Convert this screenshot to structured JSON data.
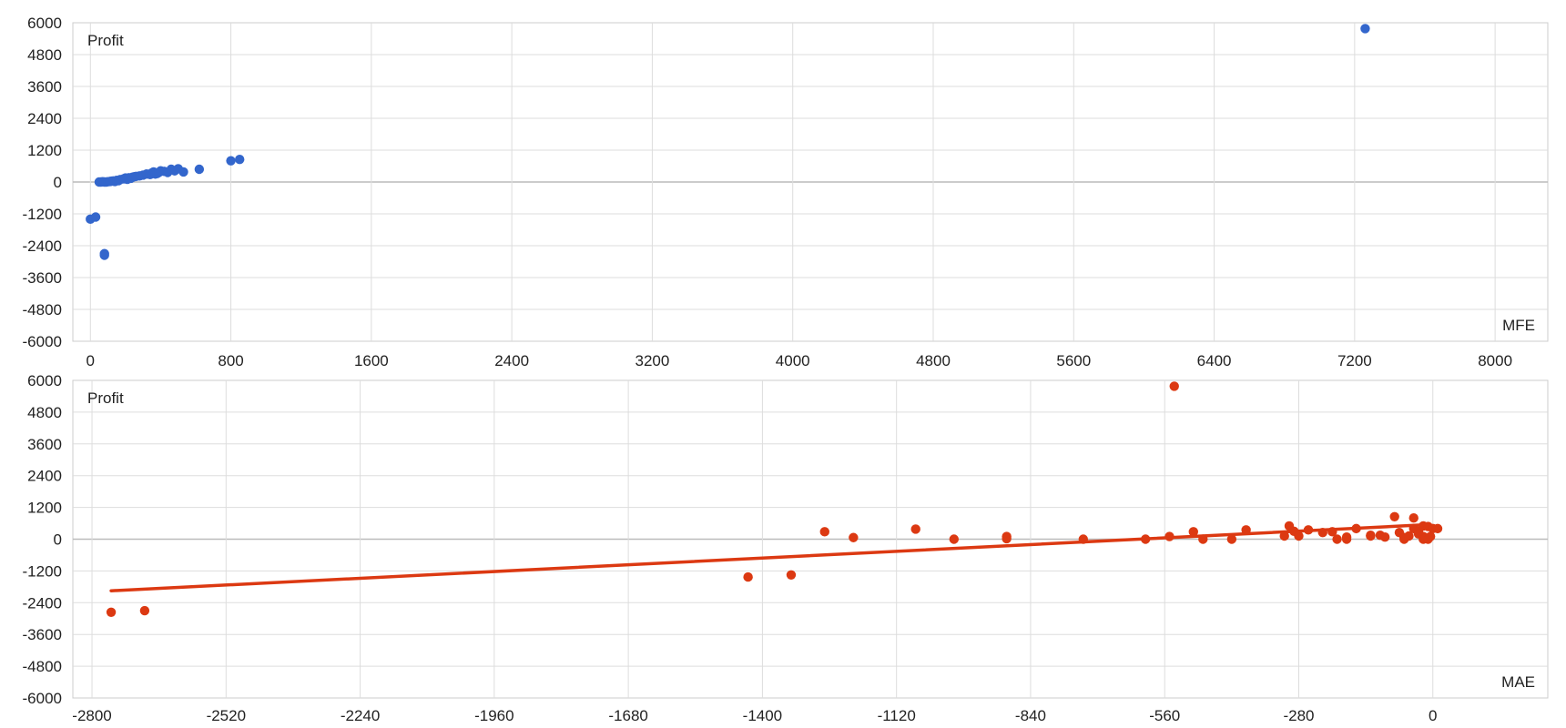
{
  "chart_data": [
    {
      "type": "scatter",
      "ylabel": "Profit",
      "xlabel": "MFE",
      "xlim": [
        -100,
        8300
      ],
      "ylim": [
        -6000,
        6000
      ],
      "x_ticks": [
        "0",
        "800",
        "1600",
        "2400",
        "3200",
        "4000",
        "4800",
        "5600",
        "6400",
        "7200",
        "8000"
      ],
      "y_ticks": [
        "6000",
        "4800",
        "3600",
        "2400",
        "1200",
        "0",
        "-1200",
        "-2400",
        "-3600",
        "-4800",
        "-6000"
      ],
      "grid": true,
      "color": "#3366cc",
      "series": [
        {
          "x": [
            0,
            30,
            80,
            80,
            50,
            60,
            70,
            80,
            90,
            100,
            110,
            120,
            130,
            140,
            150,
            160,
            170,
            190,
            200,
            210,
            220,
            230,
            240,
            250,
            260,
            280,
            300,
            320,
            340,
            350,
            360,
            370,
            380,
            390,
            400,
            420,
            440,
            460,
            480,
            500,
            530,
            620,
            800,
            850,
            7260
          ],
          "y": [
            -1400,
            -1320,
            -2700,
            -2760,
            0,
            0,
            10,
            0,
            0,
            10,
            20,
            30,
            40,
            20,
            60,
            50,
            90,
            120,
            150,
            100,
            160,
            140,
            180,
            200,
            210,
            230,
            260,
            300,
            280,
            340,
            380,
            300,
            320,
            360,
            420,
            400,
            360,
            480,
            420,
            500,
            380,
            480,
            800,
            850,
            5780
          ]
        }
      ]
    },
    {
      "type": "scatter",
      "ylabel": "Profit",
      "xlabel": "MAE",
      "xlim": [
        -2840,
        240
      ],
      "ylim": [
        -6000,
        6000
      ],
      "x_ticks": [
        "-2800",
        "-2520",
        "-2240",
        "-1960",
        "-1680",
        "-1400",
        "-1120",
        "-840",
        "-560",
        "-280",
        "0"
      ],
      "y_ticks": [
        "6000",
        "4800",
        "3600",
        "2400",
        "1200",
        "0",
        "-1200",
        "-2400",
        "-3600",
        "-4800",
        "-6000"
      ],
      "grid": true,
      "color": "#dc3912",
      "series": [
        {
          "x": [
            -2760,
            -2690,
            -1430,
            -1340,
            -1270,
            -1210,
            -1080,
            -1000,
            -890,
            -890,
            -730,
            -600,
            -550,
            -540,
            -500,
            -480,
            -420,
            -390,
            -310,
            -300,
            -290,
            -280,
            -260,
            -230,
            -210,
            -200,
            -180,
            -180,
            -160,
            -130,
            -130,
            -110,
            -100,
            -80,
            -70,
            -60,
            -60,
            -50,
            -40,
            -40,
            -30,
            -30,
            -20,
            -20,
            -20,
            -15,
            -10,
            -10,
            -5,
            0,
            10
          ],
          "y": [
            -2760,
            -2700,
            -1430,
            -1350,
            280,
            60,
            380,
            0,
            100,
            20,
            0,
            0,
            100,
            5780,
            280,
            0,
            0,
            350,
            120,
            500,
            300,
            120,
            350,
            250,
            280,
            0,
            80,
            0,
            400,
            150,
            120,
            150,
            80,
            850,
            250,
            0,
            60,
            120,
            800,
            400,
            300,
            200,
            100,
            0,
            500,
            50,
            480,
            0,
            100,
            400,
            400
          ]
        }
      ],
      "trendline": {
        "x": [
          -2760,
          -10
        ],
        "y": [
          -1950,
          550
        ]
      }
    }
  ]
}
